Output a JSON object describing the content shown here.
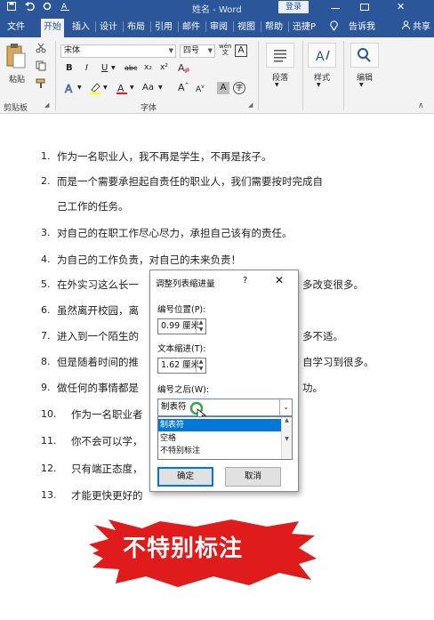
{
  "titlebar": {
    "doc_title": "姓名 - Word",
    "login": "登录"
  },
  "tabs": [
    {
      "label": "文件"
    },
    {
      "label": "开始"
    },
    {
      "label": "插入"
    },
    {
      "label": "设计"
    },
    {
      "label": "布局"
    },
    {
      "label": "引用"
    },
    {
      "label": "邮件"
    },
    {
      "label": "审阅"
    },
    {
      "label": "视图"
    },
    {
      "label": "帮助"
    },
    {
      "label": "迅捷P"
    },
    {
      "label": "告诉我"
    },
    {
      "label": "共享"
    }
  ],
  "ribbon": {
    "paste_label": "粘贴",
    "clipboard_label": "剪贴板",
    "font_name": "宋体",
    "font_size": "四号",
    "wen_label": "wén",
    "font_group_label": "字体",
    "paragraph_label": "段落",
    "styles_label": "样式",
    "editing_label": "编辑",
    "bold": "B",
    "italic": "I",
    "underline": "U",
    "strike": "abc",
    "sub": "x₂",
    "sup": "x²",
    "aa": "Aa",
    "grow": "A",
    "shrink": "A"
  },
  "document": {
    "lines": [
      {
        "num": "1.",
        "text": "作为一名职业人，我不再是学生，不再是孩子。"
      },
      {
        "num": "2.",
        "text": "而是一个需要承担起自责任的职业人，我们需要按时完成自"
      },
      {
        "num": "",
        "text": "己工作的任务。"
      },
      {
        "num": "3.",
        "text": "对自己的在职工作尽心尽力，承担自己该有的责任。"
      },
      {
        "num": "4.",
        "text": "为自己的工作负责，对自己的未来负责！"
      },
      {
        "num": "5.",
        "text": "在外实习这么长一",
        "tail": "多改变很多。"
      },
      {
        "num": "6.",
        "text": "虽然离开校园，离"
      },
      {
        "num": "7.",
        "text": "进入到一个陌生的",
        "tail": "多不适。"
      },
      {
        "num": "8.",
        "text": "但是随着时间的推",
        "tail": "自学习到很多。"
      },
      {
        "num": "9.",
        "text": "做任何的事情都是",
        "tail": "功。"
      },
      {
        "num": "10.",
        "text": "作为一名职业者"
      },
      {
        "num": "11.",
        "text": "你不会可以学，"
      },
      {
        "num": "12.",
        "text": "只有端正态度，"
      },
      {
        "num": "13.",
        "text": "才能更快更好的"
      }
    ]
  },
  "dialog": {
    "title": "调整列表缩进量",
    "help": "?",
    "close": "✕",
    "number_position_label": "编号位置(P):",
    "number_position_value": "0.99 厘米",
    "text_indent_label": "文本缩进(T):",
    "text_indent_value": "1.62 厘米",
    "follow_label": "编号之后(W):",
    "follow_value": "制表符",
    "options": [
      "制表符",
      "空格",
      "不特别标注"
    ],
    "ok": "确定",
    "cancel": "取消"
  },
  "banner": {
    "text": "不特别标注",
    "color": "#e01b1b"
  },
  "colors": {
    "brand": "#2b579a",
    "select_highlight": "#0078d7"
  }
}
